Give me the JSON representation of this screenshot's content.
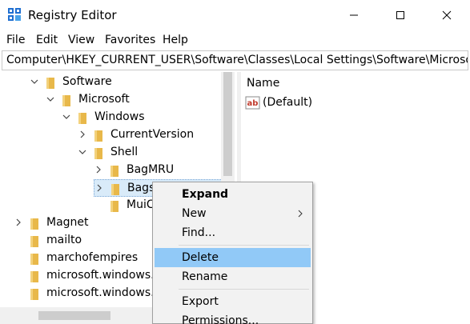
{
  "window": {
    "title": "Registry Editor",
    "icon": "registry-editor-icon"
  },
  "menubar": {
    "file": "File",
    "edit": "Edit",
    "view": "View",
    "favorites": "Favorites",
    "help": "Help"
  },
  "address": {
    "path": "Computer\\HKEY_CURRENT_USER\\Software\\Classes\\Local Settings\\Software\\Microsoft\\"
  },
  "tree": {
    "items": [
      {
        "label": "Software",
        "expander": "expanded"
      },
      {
        "label": "Microsoft",
        "expander": "expanded"
      },
      {
        "label": "Windows",
        "expander": "expanded"
      },
      {
        "label": "CurrentVersion",
        "expander": "collapsed"
      },
      {
        "label": "Shell",
        "expander": "expanded"
      },
      {
        "label": "BagMRU",
        "expander": "collapsed"
      },
      {
        "label": "Bags",
        "expander": "collapsed"
      },
      {
        "label": "MuiC",
        "expander": "none"
      },
      {
        "label": "Magnet",
        "expander": "collapsed"
      },
      {
        "label": "mailto",
        "expander": "none"
      },
      {
        "label": "marchofempires",
        "expander": "none"
      },
      {
        "label": "microsoft.windows.c",
        "expander": "none"
      },
      {
        "label": "microsoft.windows.c",
        "expander": "none"
      }
    ]
  },
  "list": {
    "column_name": "Name",
    "rows": [
      {
        "name": "(Default)",
        "icon": "string-value-icon"
      }
    ]
  },
  "context_menu": {
    "expand": "Expand",
    "new": "New",
    "find": "Find...",
    "delete": "Delete",
    "rename": "Rename",
    "export": "Export",
    "permissions": "Permissions..."
  },
  "colors": {
    "highlight": "#91c9f7",
    "folder": "#e8b84a"
  }
}
